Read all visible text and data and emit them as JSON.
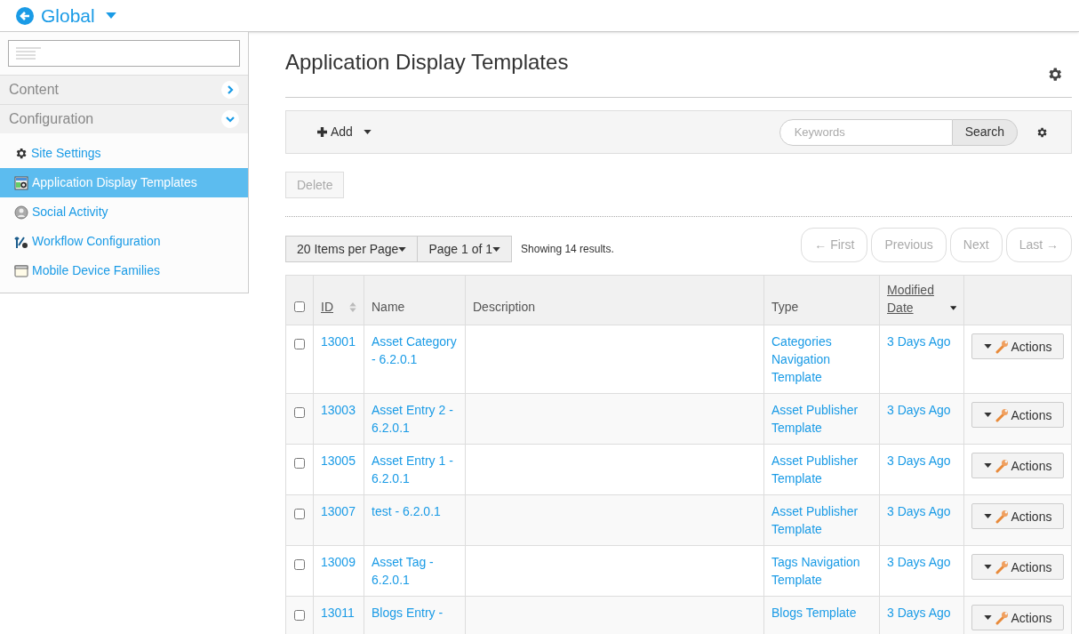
{
  "header": {
    "title": "Global"
  },
  "sidebar": {
    "sections": [
      {
        "label": "Content",
        "expanded": false
      },
      {
        "label": "Configuration",
        "expanded": true
      }
    ],
    "items": [
      {
        "label": "Site Settings",
        "kind": "gear",
        "selected": false
      },
      {
        "label": "Application Display Templates",
        "kind": "template",
        "selected": true
      },
      {
        "label": "Social Activity",
        "kind": "person",
        "selected": false
      },
      {
        "label": "Workflow Configuration",
        "kind": "workflow",
        "selected": false
      },
      {
        "label": "Mobile Device Families",
        "kind": "window",
        "selected": false
      }
    ]
  },
  "page": {
    "title": "Application Display Templates"
  },
  "toolbar": {
    "add": "Add",
    "search": {
      "placeholder": "Keywords",
      "button": "Search"
    }
  },
  "delete": {
    "label": "Delete",
    "disabled": true
  },
  "pagination": {
    "per_page": "20 Items per Page",
    "page": "Page 1 of 1",
    "results": "Showing 14 results.",
    "buttons": [
      {
        "label": "← First",
        "disabled": true
      },
      {
        "label": "Previous",
        "disabled": true
      },
      {
        "label": "Next",
        "disabled": true
      },
      {
        "label": "Last →",
        "disabled": true
      }
    ]
  },
  "table": {
    "select_all": {
      "checked": false
    },
    "columns": [
      "ID",
      "Name",
      "Description",
      "Type",
      "Modified Date"
    ],
    "rows": [
      {
        "checked": false,
        "id": "13001",
        "name": "Asset Category - 6.2.0.1",
        "type": "Categories Navigation Template",
        "modified": "3 Days Ago",
        "action": "Actions"
      },
      {
        "checked": false,
        "id": "13003",
        "name": "Asset Entry 2 - 6.2.0.1",
        "type": "Asset Publisher Template",
        "modified": "3 Days Ago",
        "action": "Actions"
      },
      {
        "checked": false,
        "id": "13005",
        "name": "Asset Entry 1 - 6.2.0.1",
        "type": "Asset Publisher Template",
        "modified": "3 Days Ago",
        "action": "Actions"
      },
      {
        "checked": false,
        "id": "13007",
        "name": "test - 6.2.0.1",
        "type": "Asset Publisher Template",
        "modified": "3 Days Ago",
        "action": "Actions"
      },
      {
        "checked": false,
        "id": "13009",
        "name": "Asset Tag - 6.2.0.1",
        "type": "Tags Navigation Template",
        "modified": "3 Days Ago",
        "action": "Actions"
      },
      {
        "checked": false,
        "id": "13011",
        "name": "Blogs Entry -",
        "type": "Blogs Template",
        "modified": "3 Days Ago",
        "action": "Actions"
      }
    ]
  }
}
